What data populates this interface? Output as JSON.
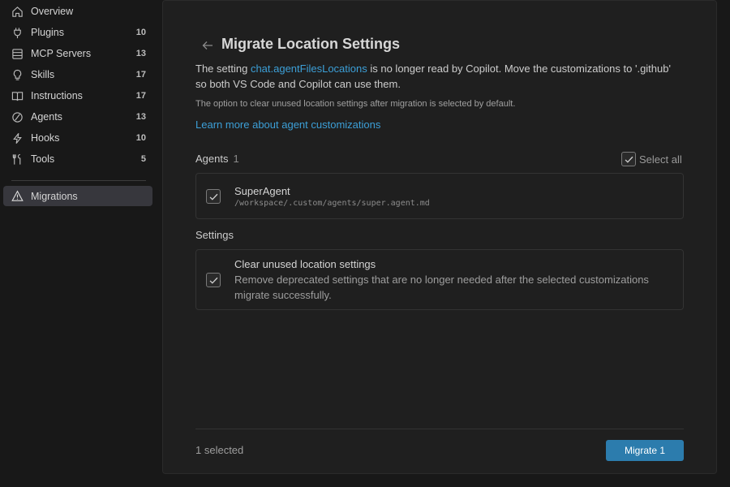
{
  "sidebar": {
    "items": [
      {
        "label": "Overview",
        "count": "",
        "icon": "home-icon"
      },
      {
        "label": "Plugins",
        "count": "10",
        "icon": "plug-icon"
      },
      {
        "label": "MCP Servers",
        "count": "13",
        "icon": "server-icon"
      },
      {
        "label": "Skills",
        "count": "17",
        "icon": "lightbulb-icon"
      },
      {
        "label": "Instructions",
        "count": "17",
        "icon": "book-icon"
      },
      {
        "label": "Agents",
        "count": "13",
        "icon": "agent-icon"
      },
      {
        "label": "Hooks",
        "count": "10",
        "icon": "lightning-icon"
      },
      {
        "label": "Tools",
        "count": "5",
        "icon": "tools-icon"
      }
    ],
    "migrations": {
      "label": "Migrations",
      "icon": "warning-icon"
    }
  },
  "main": {
    "title": "Migrate Location Settings",
    "desc_prefix": "The setting ",
    "desc_link": "chat.agentFilesLocations",
    "desc_suffix": " is no longer read by Copilot. Move the customizations to '.github' so both VS Code and Copilot can use them.",
    "note": "The option to clear unused location settings after migration is selected by default.",
    "learn_more": "Learn more about agent customizations",
    "agents_section": {
      "title": "Agents",
      "count": "1"
    },
    "select_all": "Select all",
    "agent_item": {
      "name": "SuperAgent",
      "path": "/workspace/.custom/agents/super.agent.md",
      "checked": true
    },
    "settings_section": {
      "title": "Settings"
    },
    "settings_item": {
      "name": "Clear unused location settings",
      "description": "Remove deprecated settings that are no longer needed after the selected customizations migrate successfully.",
      "checked": true
    },
    "footer": {
      "selected": "1 selected",
      "button": "Migrate 1"
    }
  },
  "colors": {
    "accent": "#2c7cad",
    "link": "#3c9fd7",
    "background": "#181818",
    "panel": "#1f1f1f"
  }
}
